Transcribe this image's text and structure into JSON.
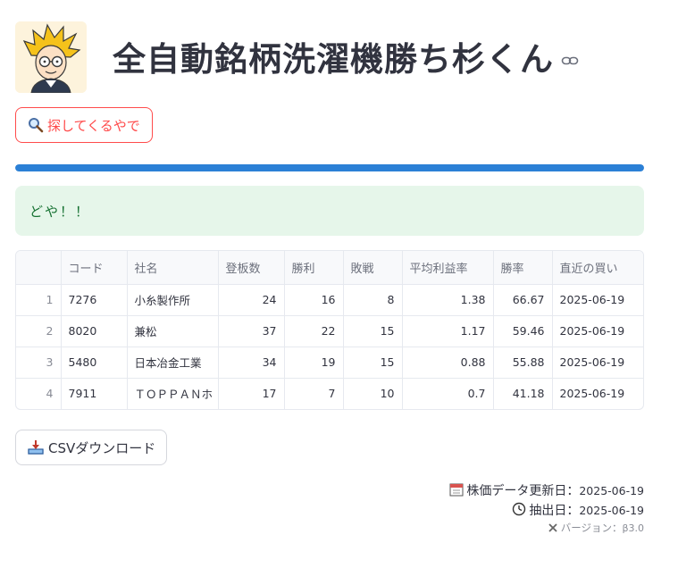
{
  "header": {
    "title": "全自動銘柄洗濯機勝ち杉くん",
    "avatar_icon": "cartoon-avatar-icon",
    "link_icon": "link-icon"
  },
  "search_button": {
    "icon": "magnifier-icon",
    "label": "探してくるやで"
  },
  "progress": {
    "value_percent": 100,
    "color": "#2b80d6"
  },
  "alert": {
    "text": "どや！！",
    "bg": "#e6f6ea",
    "color": "#177233"
  },
  "table": {
    "columns": [
      "",
      "コード",
      "社名",
      "登板数",
      "勝利",
      "敗戦",
      "平均利益率",
      "勝率",
      "直近の買い"
    ],
    "rows": [
      [
        "1",
        "7276",
        "小糸製作所",
        "24",
        "16",
        "8",
        "1.38",
        "66.67",
        "2025-06-19"
      ],
      [
        "2",
        "8020",
        "兼松",
        "37",
        "22",
        "15",
        "1.17",
        "59.46",
        "2025-06-19"
      ],
      [
        "3",
        "5480",
        "日本冶金工業",
        "34",
        "19",
        "15",
        "0.88",
        "55.88",
        "2025-06-19"
      ],
      [
        "4",
        "7911",
        "ＴＯＰＰＡＮホ",
        "17",
        "7",
        "10",
        "0.7",
        "41.18",
        "2025-06-19"
      ]
    ]
  },
  "csv_button": {
    "icon": "download-tray-icon",
    "label": "CSVダウンロード"
  },
  "footer": {
    "price_update_label": "株価データ更新日：",
    "price_update_value": "2025-06-19",
    "extract_label": "抽出日：",
    "extract_value": "2025-06-19",
    "version_label": "バージョン：",
    "version_value": "β3.0"
  },
  "colors": {
    "accent": "#ff4b4b",
    "text": "#31333f",
    "border": "#e6e9ef"
  }
}
